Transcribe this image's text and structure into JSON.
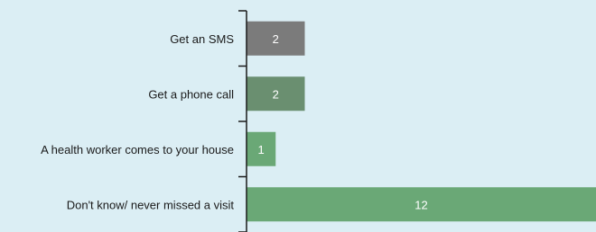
{
  "chart_data": {
    "type": "bar",
    "orientation": "horizontal",
    "title": "",
    "xlabel": "",
    "ylabel": "",
    "categories": [
      "Get an SMS",
      "Get a phone call",
      "A health worker comes to your house",
      "Don't know/ never missed a visit"
    ],
    "values": [
      2,
      2,
      1,
      12
    ],
    "value_labels": [
      "2",
      "2",
      "1",
      "12"
    ],
    "bar_colors": [
      "#7b7b7b",
      "#6a8f70",
      "#6aa876",
      "#6aa876"
    ],
    "xlim": [
      0,
      12
    ],
    "grid": false,
    "legend": "none"
  },
  "colors": {
    "background": "#dbeef4",
    "axis": "#1a1a1a"
  }
}
